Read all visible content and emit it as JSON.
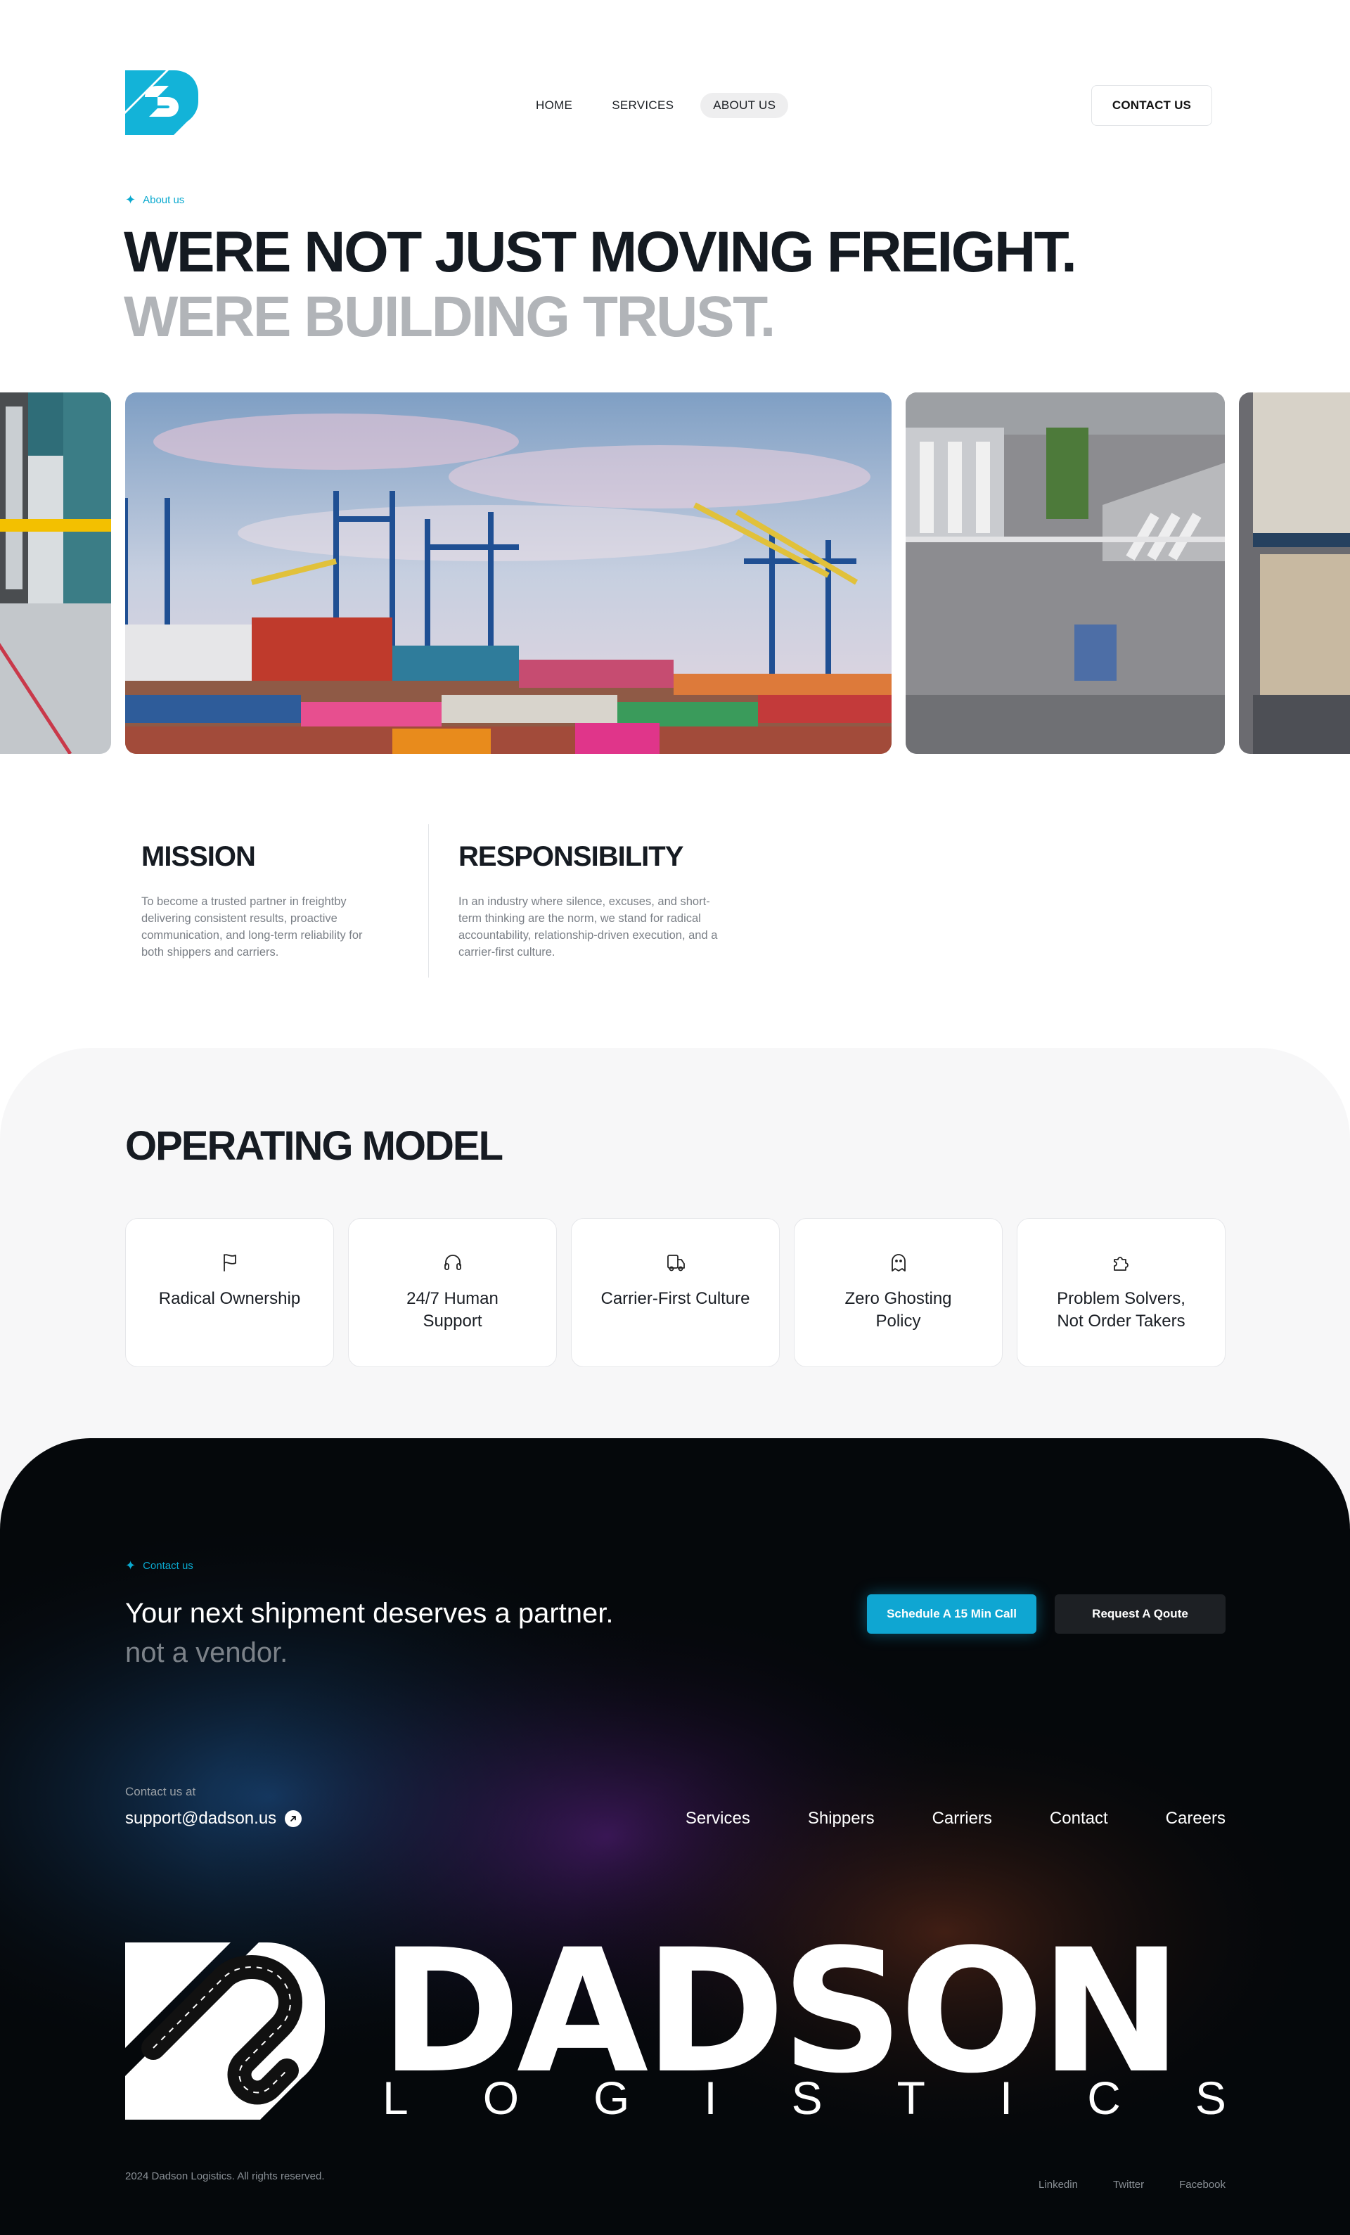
{
  "header": {
    "logo_icon": "dadson-s-logo",
    "nav": [
      {
        "label": "HOME",
        "active": false
      },
      {
        "label": "SERVICES",
        "active": false
      },
      {
        "label": "ABOUT US",
        "active": true
      }
    ],
    "contact_button": "CONTACT US"
  },
  "hero": {
    "kicker": "About us",
    "kicker_icon": "sparkle-icon",
    "title_line1": "WERE NOT JUST MOVING FREIGHT.",
    "title_line2": "WERE BUILDING TRUST.",
    "images": [
      "warehouse-dock-image",
      "container-port-image",
      "aerial-truck-yard-image",
      "warehouse-shelves-image"
    ]
  },
  "values": {
    "mission": {
      "title": "MISSION",
      "text": "To become a trusted partner in freightby delivering consistent results, proactive communication, and long-term reliability for both shippers and carriers."
    },
    "responsibility": {
      "title": "RESPONSIBILITY",
      "text": "In an industry where silence, excuses, and short-term thinking are the norm, we stand for radical accountability, relationship-driven execution, and a carrier-first culture."
    }
  },
  "operating_model": {
    "title": "OPERATING MODEL",
    "cards": [
      {
        "label": "Radical Ownership",
        "icon": "flag-icon"
      },
      {
        "label": "24/7 Human Support",
        "icon": "headphones-icon"
      },
      {
        "label": "Carrier-First Culture",
        "icon": "truck-icon"
      },
      {
        "label": "Zero Ghosting Policy",
        "icon": "ghost-icon"
      },
      {
        "label": "Problem Solvers, Not Order Takers",
        "icon": "puzzle-icon"
      }
    ]
  },
  "footer": {
    "kicker": "Contact us",
    "headline": "Your next shipment deserves a partner.",
    "subheadline": "not a vendor.",
    "schedule_button": "Schedule A 15 Min Call",
    "quote_button": "Request A Qoute",
    "contact_label": "Contact us at",
    "email": "support@dadson.us",
    "links": [
      "Services",
      "Shippers",
      "Carriers",
      "Contact",
      "Careers"
    ],
    "brand_name": "DADSON",
    "brand_sub": [
      "L",
      "O",
      "G",
      "I",
      "S",
      "T",
      "I",
      "C",
      "S"
    ],
    "copyright": "2024 Dadson Logistics. All rights reserved.",
    "social": [
      "Linkedin",
      "Twitter",
      "Facebook"
    ]
  },
  "colors": {
    "accent": "#0fa6d2",
    "dark": "#05080b",
    "text": "#161b22",
    "muted": "#b1b4b8"
  }
}
